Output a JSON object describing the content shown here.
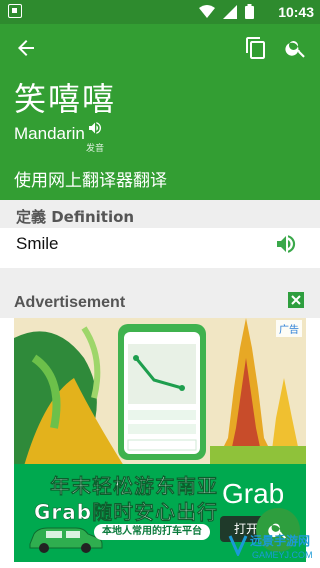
{
  "status_bar": {
    "time": "10:43",
    "icons": [
      "app-notification-icon",
      "wifi-icon",
      "signal-icon",
      "battery-icon"
    ]
  },
  "app_bar": {
    "icons": [
      "back-arrow-icon",
      "copy-icon",
      "search-icon"
    ],
    "word": "笑嘻嘻",
    "language": "Mandarin",
    "pronounce_label": "发音",
    "translate_label": "使用网上翻译器翻译"
  },
  "definition": {
    "header": "定義 Definition",
    "meaning": "Smile",
    "speaker_icon": "volume-icon"
  },
  "advertisement": {
    "header": "Advertisement",
    "tag": "广告",
    "headline_1": "年末轻松游东南亚",
    "headline_2": "Grab随时安心出行",
    "brand": "Grab",
    "slogan": "本地人常用的打车平台",
    "button_label": "打开"
  },
  "watermark": {
    "line1": "远景手游网",
    "line2": "GAMEYJ.COM"
  },
  "colors": {
    "status_bar": "#2e8b2e",
    "app_bar": "#339e33",
    "accent": "#2e9e3e",
    "ad_green": "#00a94f"
  }
}
